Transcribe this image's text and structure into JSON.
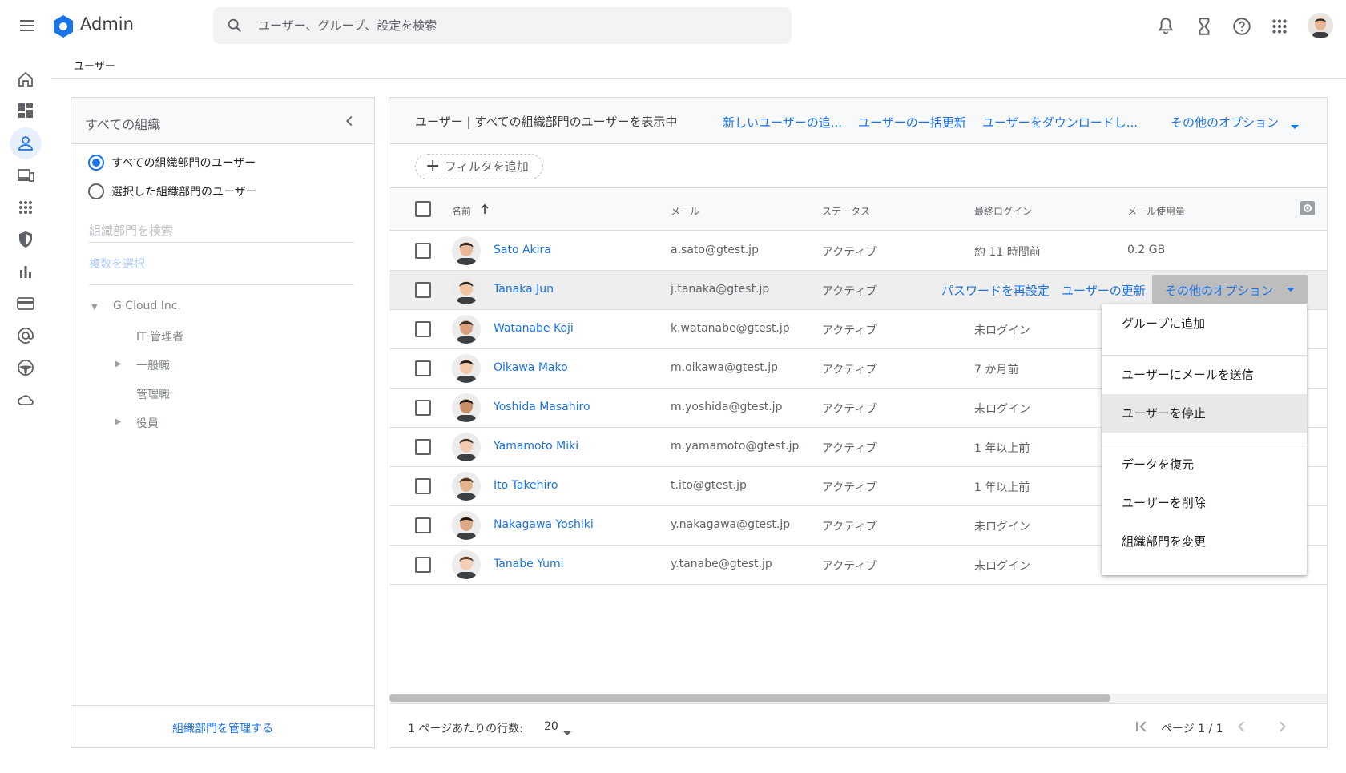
{
  "app": {
    "title": "Admin"
  },
  "search": {
    "placeholder": "ユーザー、グループ、設定を検索"
  },
  "breadcrumb": "ユーザー",
  "org_panel": {
    "title": "すべての組織",
    "radio_all": "すべての組織部門のユーザー",
    "radio_selected": "選択した組織部門のユーザー",
    "search_placeholder": "組織部門を検索",
    "multi_select": "複数を選択",
    "tree": [
      "G Cloud Inc.",
      "IT 管理者",
      "一般職",
      "管理職",
      "役員"
    ],
    "manage_link": "組織部門を管理する"
  },
  "users_panel": {
    "title": "ユーザー | すべての組織部門のユーザーを表示中",
    "add_user": "新しいユーザーの追...",
    "bulk_update": "ユーザーの一括更新",
    "download": "ユーザーをダウンロードし...",
    "more_options": "その他のオプション",
    "filter_chip": "フィルタを追加",
    "columns": {
      "name": "名前",
      "email": "メール",
      "status": "ステータス",
      "last_login": "最終ログイン",
      "mail_usage": "メール使用量"
    },
    "rows": [
      {
        "name": "Sato Akira",
        "email": "a.sato@gtest.jp",
        "status": "アクティブ",
        "last_login": "約 11 時間前",
        "usage": "0.2 GB"
      },
      {
        "name": "Tanaka Jun",
        "email": "j.tanaka@gtest.jp",
        "status": "アクティブ",
        "last_login": "",
        "usage": ""
      },
      {
        "name": "Watanabe Koji",
        "email": "k.watanabe@gtest.jp",
        "status": "アクティブ",
        "last_login": "未ログイン",
        "usage": ""
      },
      {
        "name": "Oikawa Mako",
        "email": "m.oikawa@gtest.jp",
        "status": "アクティブ",
        "last_login": "7 か月前",
        "usage": ""
      },
      {
        "name": "Yoshida Masahiro",
        "email": "m.yoshida@gtest.jp",
        "status": "アクティブ",
        "last_login": "未ログイン",
        "usage": ""
      },
      {
        "name": "Yamamoto Miki",
        "email": "m.yamamoto@gtest.jp",
        "status": "アクティブ",
        "last_login": "1 年以上前",
        "usage": ""
      },
      {
        "name": "Ito Takehiro",
        "email": "t.ito@gtest.jp",
        "status": "アクティブ",
        "last_login": "1 年以上前",
        "usage": ""
      },
      {
        "name": "Nakagawa Yoshiki",
        "email": "y.nakagawa@gtest.jp",
        "status": "アクティブ",
        "last_login": "未ログイン",
        "usage": ""
      },
      {
        "name": "Tanabe Yumi",
        "email": "y.tanabe@gtest.jp",
        "status": "アクティブ",
        "last_login": "未ログイン",
        "usage": ""
      }
    ],
    "row_actions": {
      "reset_password": "パスワードを再設定",
      "update_user": "ユーザーの更新",
      "more_options": "その他のオプション"
    },
    "menu": [
      "グループに追加",
      "ユーザーにメールを送信",
      "ユーザーを停止",
      "データを復元",
      "ユーザーを削除",
      "組織部門を変更"
    ],
    "pager": {
      "rows_label": "1 ページあたりの行数:",
      "rows_value": "20",
      "page_label": "ページ 1 / 1"
    }
  },
  "colors": {
    "accent": "#1a73e8",
    "text": "#202124",
    "muted": "#5f6368"
  }
}
